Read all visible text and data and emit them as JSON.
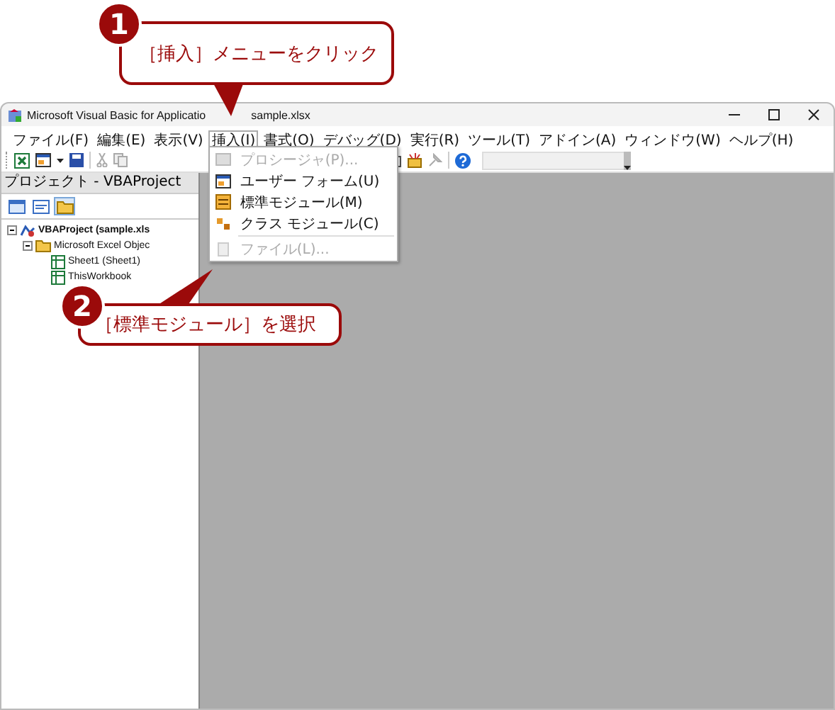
{
  "callouts": [
    {
      "number": "1",
      "text": "［挿入］メニューをクリック"
    },
    {
      "number": "2",
      "text": "［標準モジュール］を選択"
    }
  ],
  "window": {
    "title_parts": [
      "Microsoft Visual Basic for Applicatio",
      "sample.xlsx"
    ]
  },
  "menu_bar": [
    {
      "label": "ファイル(F)",
      "selected": false
    },
    {
      "label": "編集(E)",
      "selected": false
    },
    {
      "label": "表示(V)",
      "selected": false
    },
    {
      "label": "挿入(I)",
      "selected": true
    },
    {
      "label": "書式(O)",
      "selected": false
    },
    {
      "label": "デバッグ(D)",
      "selected": false
    },
    {
      "label": "実行(R)",
      "selected": false
    },
    {
      "label": "ツール(T)",
      "selected": false
    },
    {
      "label": "アドイン(A)",
      "selected": false
    },
    {
      "label": "ウィンドウ(W)",
      "selected": false
    },
    {
      "label": "ヘルプ(H)",
      "selected": false
    }
  ],
  "insert_menu": [
    {
      "label": "プロシージャ(P)...",
      "disabled": true
    },
    {
      "label": "ユーザー フォーム(U)",
      "disabled": false
    },
    {
      "label": "標準モジュール(M)",
      "disabled": false
    },
    {
      "label": "クラス モジュール(C)",
      "disabled": false
    },
    {
      "label": "ファイル(L)...",
      "disabled": true
    }
  ],
  "project_panel": {
    "title": "プロジェクト - VBAProject",
    "view_buttons": [
      {
        "selected": false
      },
      {
        "selected": false
      },
      {
        "selected": true
      }
    ],
    "tree": [
      {
        "label": "VBAProject (sample.xls",
        "expanded": true,
        "children": [
          {
            "label": "Microsoft Excel Objec",
            "expanded": true,
            "children": [
              {
                "label": "Sheet1 (Sheet1)"
              },
              {
                "label": "ThisWorkbook"
              }
            ]
          }
        ]
      }
    ]
  }
}
